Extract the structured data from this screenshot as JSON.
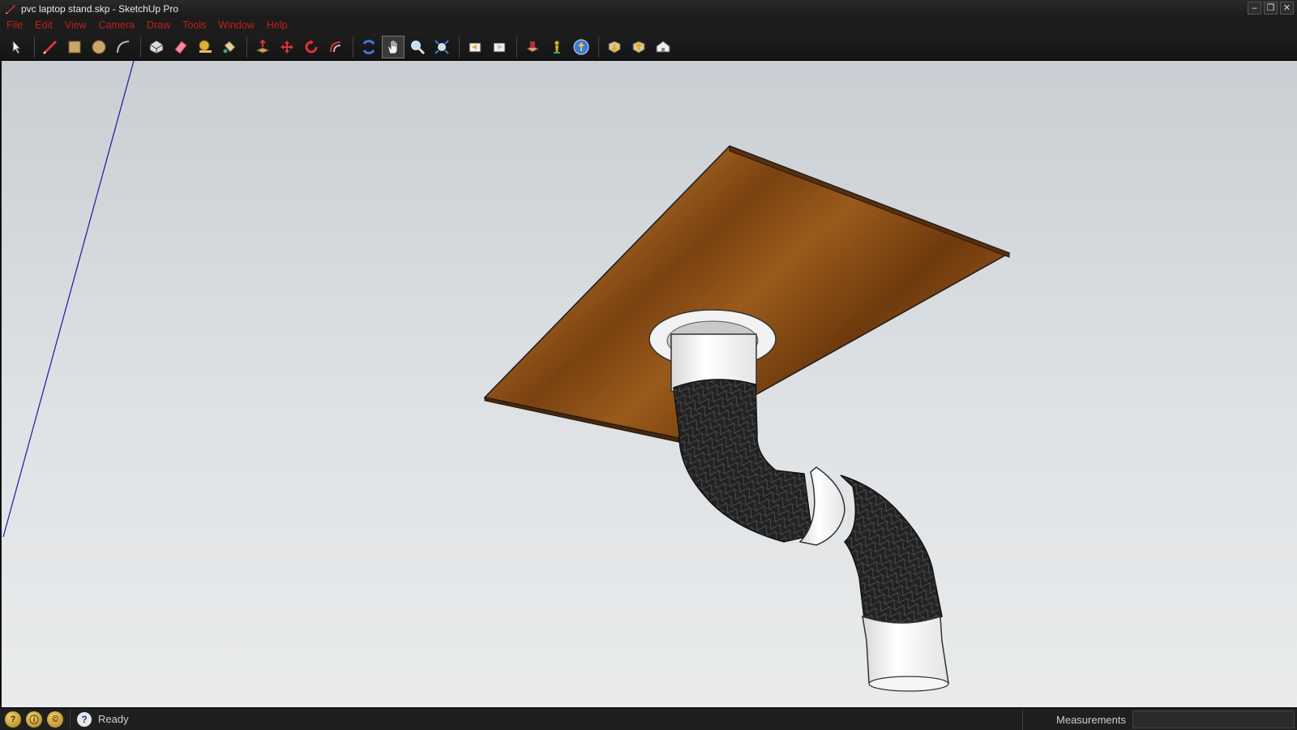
{
  "window": {
    "title": "pvc laptop stand.skp - SketchUp Pro",
    "controls": {
      "minimize": "–",
      "restore": "❐",
      "close": "✕"
    }
  },
  "menu": [
    "File",
    "Edit",
    "View",
    "Camera",
    "Draw",
    "Tools",
    "Window",
    "Help"
  ],
  "toolbar": {
    "groups": [
      [
        "select-icon"
      ],
      [
        "line-icon",
        "rectangle-icon",
        "circle-icon",
        "arc-icon"
      ],
      [
        "make-component-icon",
        "eraser-icon",
        "tape-measure-icon",
        "paint-bucket-icon"
      ],
      [
        "push-pull-icon",
        "move-icon",
        "rotate-icon",
        "offset-icon"
      ],
      [
        "orbit-icon",
        "pan-icon",
        "zoom-icon",
        "zoom-extents-icon"
      ],
      [
        "previous-view-icon",
        "next-view-icon"
      ],
      [
        "add-location-icon",
        "toggle-terrain-icon",
        "photo-textures-icon"
      ],
      [
        "get-models-icon",
        "share-model-icon",
        "extension-warehouse-icon"
      ]
    ],
    "active_tool": "pan-icon"
  },
  "status": {
    "text": "Ready",
    "measurements_label": "Measurements",
    "measurements_value": ""
  },
  "colors": {
    "menu_text": "#c21e1e",
    "wood": "#8a4a17",
    "pvc_white": "#f4f4f4",
    "pvc_black": "#1e1e1e",
    "axis_blue": "#1a1a9c"
  }
}
